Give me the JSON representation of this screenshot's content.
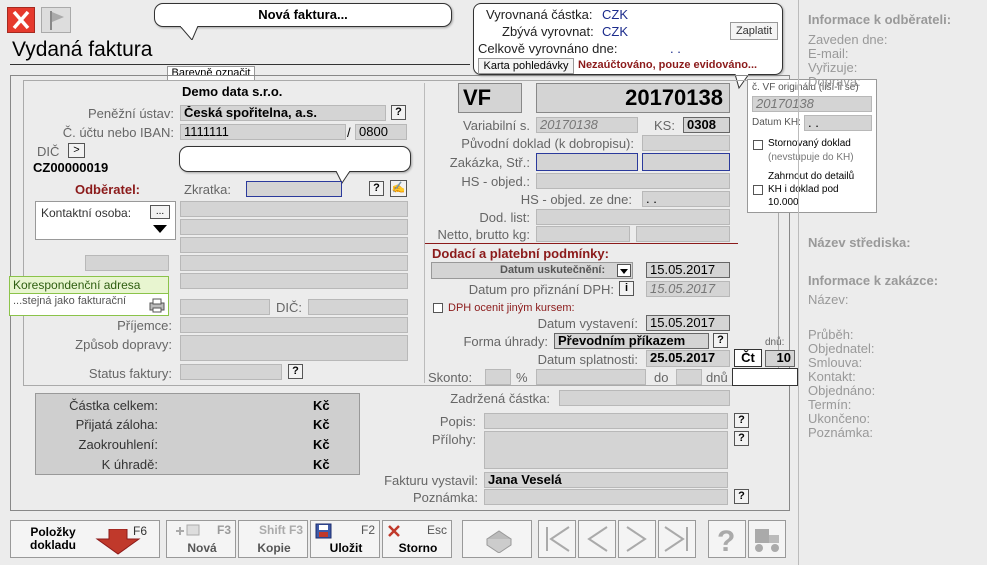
{
  "window": {
    "title": "Vydaná faktura",
    "subtitle_callout": "Nová faktura...",
    "color_mark_label": "Barevně označit"
  },
  "payment_box": {
    "settled_label": "Vyrovnaná částka:",
    "settled_currency": "CZK",
    "remaining_label": "Zbývá vyrovnat:",
    "remaining_currency": "CZK",
    "settled_date_label": "Celkově vyrovnáno dne:",
    "settled_date_value": ". .",
    "pay_button": "Zaplatit",
    "receivable_card_button": "Karta pohledávky",
    "status": "Nezaúčtováno, pouze evidováno..."
  },
  "supplier": {
    "company": "Demo data s.r.o.",
    "bank_label": "Peněžní ústav:",
    "bank_value": "Česká spořitelna, a.s.",
    "account_label": "Č. účtu nebo IBAN:",
    "account_value": "1111111",
    "bank_code_sep": "/",
    "bank_code": "0800",
    "dic_label": "DIČ",
    "dic_btn": ">",
    "dic_value": "CZ00000019"
  },
  "customer": {
    "header": "Odběratel:",
    "short_label": "Zkratka:",
    "contact_label": "Kontaktní osoba:",
    "contact_btn": "...",
    "corr_address_label": "Korespondenční adresa",
    "corr_address_value": "...stejná jako fakturační",
    "dic_label": "DIČ:",
    "recipient_label": "Příjemce:",
    "transport_label": "Způsob dopravy:",
    "status_label": "Status faktury:"
  },
  "doc": {
    "prefix": "VF",
    "number": "20170138",
    "vs_label": "Variabilní s.",
    "vs_value": "20170138",
    "ks_label": "KS:",
    "ks_value": "0308",
    "orig_doc_label": "Původní doklad (k dobropisu):",
    "order_label": "Zakázka, Stř.:",
    "hs_order_label": "HS - objed.:",
    "hs_date_label": "HS - objed. ze dne:",
    "hs_date_value": ". .",
    "delivery_label": "Dod. list:",
    "weight_label": "Netto, brutto kg:",
    "orig_vf_label": "č. VF originálu (liší-li se)",
    "orig_vf_value": "20170138",
    "kh_date_label": "Datum KH:",
    "kh_date_value": ". .",
    "storno_label_1": "Stornovaný doklad",
    "storno_label_2": "(nevstupuje do KH)",
    "include_label_1": "Zahrnout do detailů",
    "include_label_2": "KH i doklad pod",
    "include_label_3": "10.000"
  },
  "terms": {
    "header": "Dodací a platební podmínky:",
    "realization_label": "Datum uskutečnění:",
    "realization_value": "15.05.2017",
    "vat_date_label": "Datum pro přiznání DPH:",
    "vat_btn": "i",
    "vat_date_value": "15.05.2017",
    "other_rate_label": "DPH ocenit jiným kursem:",
    "issue_label": "Datum vystavení:",
    "issue_value": "15.05.2017",
    "payment_form_label": "Forma úhrady:",
    "payment_form_value": "Převodním příkazem",
    "due_label": "Datum splatnosti:",
    "due_value": "25.05.2017",
    "due_day": "Čt",
    "days_label": "dnů:",
    "days_value": "10",
    "discount_label": "Skonto:",
    "percent": "%",
    "until": "do",
    "days_suffix": "dnů"
  },
  "totals": {
    "total_label": "Částka celkem:",
    "total_cur": "Kč",
    "advance_label": "Přijatá záloha:",
    "advance_cur": "Kč",
    "rounding_label": "Zaokrouhlení:",
    "rounding_cur": "Kč",
    "due_label": "K úhradě:",
    "due_cur": "Kč"
  },
  "misc": {
    "retained_label": "Zadržená částka:",
    "description_label": "Popis:",
    "attachments_label": "Přílohy:",
    "issued_by_label": "Fakturu vystavil:",
    "issued_by_value": "Jana Veselá",
    "note_label": "Poznámka:"
  },
  "right_panel": {
    "customer_head": "Informace k odběrateli:",
    "customer_items": [
      "Zaveden dne:",
      "E-mail:",
      "Vyřizuje:",
      "Doprava:"
    ],
    "center_head": "Název střediska:",
    "order_head": "Informace k zakázce:",
    "order_items": [
      "Název:",
      "Průběh:",
      "Objednatel:",
      "Smlouva:",
      "Kontakt:",
      "Objednáno:",
      "Termín:",
      "Ukončeno:",
      "Poznámka:"
    ]
  },
  "toolbar": {
    "items_btn": "Položky dokladu",
    "items_key": "F6",
    "new_key": "F3",
    "new_label": "Nová",
    "copy_key": "Shift F3",
    "copy_label": "Kopie",
    "save_key": "F2",
    "save_label": "Uložit",
    "storno_key": "Esc",
    "storno_label": "Storno"
  },
  "colors": {
    "accent_red": "#c0392b",
    "header_red": "#8b1a1a"
  }
}
